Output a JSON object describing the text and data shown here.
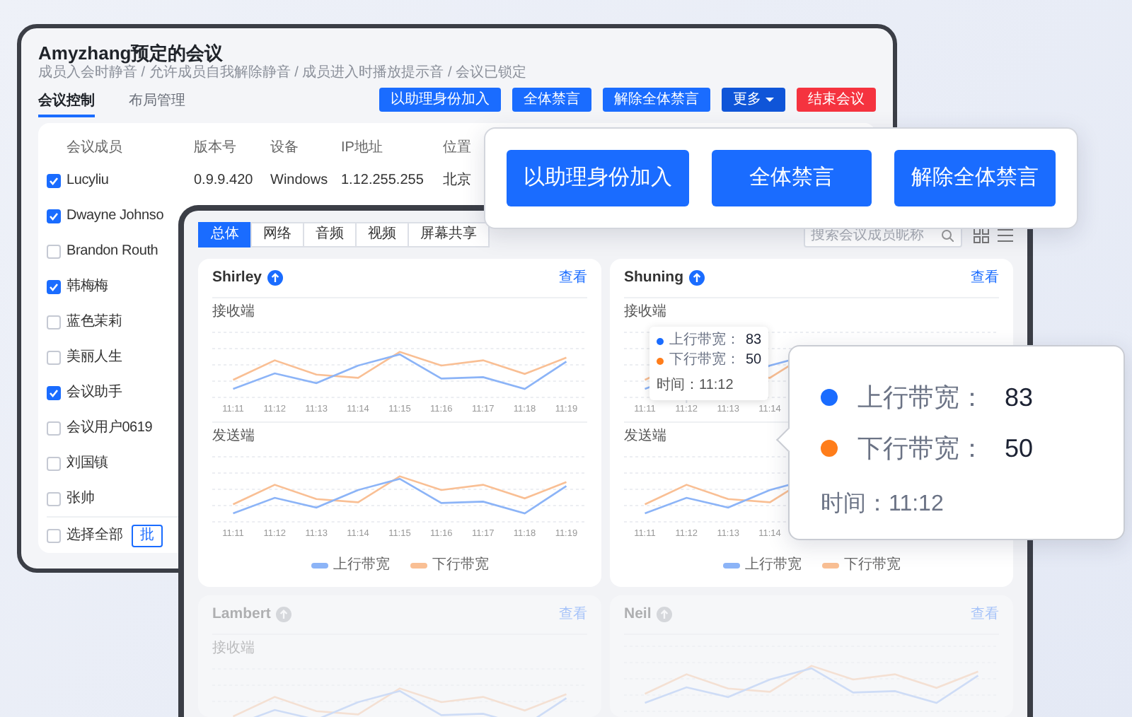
{
  "meeting_window": {
    "title": "Amyzhang预定的会议",
    "subtitle": "成员入会时静音 / 允许成员自我解除静音 / 成员进入时播放提示音 / 会议已锁定",
    "tabs": [
      {
        "label": "会议控制",
        "selected": true
      },
      {
        "label": "布局管理",
        "selected": false
      }
    ],
    "buttons": [
      {
        "label": "以助理身份加入",
        "kind": "primary"
      },
      {
        "label": "全体禁言",
        "kind": "primary"
      },
      {
        "label": "解除全体禁言",
        "kind": "primary"
      },
      {
        "label": "更多",
        "kind": "dropdown"
      },
      {
        "label": "结束会议",
        "kind": "danger"
      }
    ],
    "table": {
      "columns": [
        "会议成员",
        "版本号",
        "设备",
        "IP地址",
        "位置"
      ],
      "rows": [
        {
          "checked": true,
          "cells": [
            "Lucyliu",
            "0.9.9.420",
            "Windows",
            "1.12.255.255",
            "北京"
          ]
        },
        {
          "checked": true,
          "cells": [
            "Dwayne Johnso"
          ]
        },
        {
          "checked": false,
          "cells": [
            "Brandon Routh"
          ]
        },
        {
          "checked": true,
          "cells": [
            "韩梅梅"
          ]
        },
        {
          "checked": false,
          "cells": [
            "蓝色茉莉"
          ]
        },
        {
          "checked": false,
          "cells": [
            "美丽人生"
          ]
        },
        {
          "checked": true,
          "cells": [
            "会议助手"
          ]
        },
        {
          "checked": false,
          "cells": [
            "会议用户0619"
          ]
        },
        {
          "checked": false,
          "cells": [
            "刘国镇"
          ]
        },
        {
          "checked": false,
          "cells": [
            "张帅"
          ]
        }
      ],
      "select_all": {
        "label": "选择全部",
        "checked": false
      },
      "batch_button": "批"
    }
  },
  "monitor_window": {
    "tabs": [
      {
        "label": "总体",
        "selected": true
      },
      {
        "label": "网络",
        "selected": false
      },
      {
        "label": "音频",
        "selected": false
      },
      {
        "label": "视频",
        "selected": false
      },
      {
        "label": "屏幕共享",
        "selected": false
      }
    ],
    "search": {
      "placeholder": "搜索会议成员昵称"
    },
    "cards": [
      {
        "name": "Shirley",
        "faded": false,
        "link": "查看",
        "charts": [
          {
            "title": "接收端",
            "x_labels": [
              "11:11",
              "11:12",
              "11:13",
              "11:14",
              "11:15",
              "11:16",
              "11:17",
              "11:18",
              "11:19"
            ]
          },
          {
            "title": "发送端",
            "x_labels": [
              "11:11",
              "11:12",
              "11:13",
              "11:14",
              "11:15",
              "11:16",
              "11:17",
              "11:18",
              "11:19"
            ]
          }
        ],
        "legend": [
          {
            "label": "上行带宽",
            "color": "#8cb4f7"
          },
          {
            "label": "下行带宽",
            "color": "#f9bf94"
          }
        ]
      },
      {
        "name": "Shuning",
        "faded": false,
        "link": "查看",
        "charts": [
          {
            "title": "接收端",
            "x_labels": [
              "11:11",
              "11:12",
              "11:13",
              "11:14"
            ]
          },
          {
            "title": "发送端",
            "x_labels": [
              "11:11",
              "11:12",
              "11:13",
              "11:14"
            ]
          }
        ],
        "legend": [
          {
            "label": "上行带宽",
            "color": "#8cb4f7"
          },
          {
            "label": "下行带宽",
            "color": "#f9bf94"
          }
        ],
        "tooltip": {
          "rows": [
            {
              "label": "上行带宽：",
              "value": "83",
              "color": "#1a6cff"
            },
            {
              "label": "下行带宽：",
              "value": "50",
              "color": "#ff7d1a"
            }
          ],
          "time": "时间：11:12"
        }
      },
      {
        "name": "Lambert",
        "faded": true,
        "link": "查看",
        "charts": [
          {
            "title": "接收端"
          }
        ]
      },
      {
        "name": "Neil",
        "faded": true,
        "link": "查看"
      }
    ]
  },
  "action_popup": {
    "buttons": [
      "以助理身份加入",
      "全体禁言",
      "解除全体禁言"
    ]
  },
  "detail_tooltip": {
    "rows": [
      {
        "label": "上行带宽：",
        "value": "83",
        "color": "#1a6cff"
      },
      {
        "label": "下行带宽：",
        "value": "50",
        "color": "#ff7d1a"
      }
    ],
    "time": "时间：11:12"
  }
}
